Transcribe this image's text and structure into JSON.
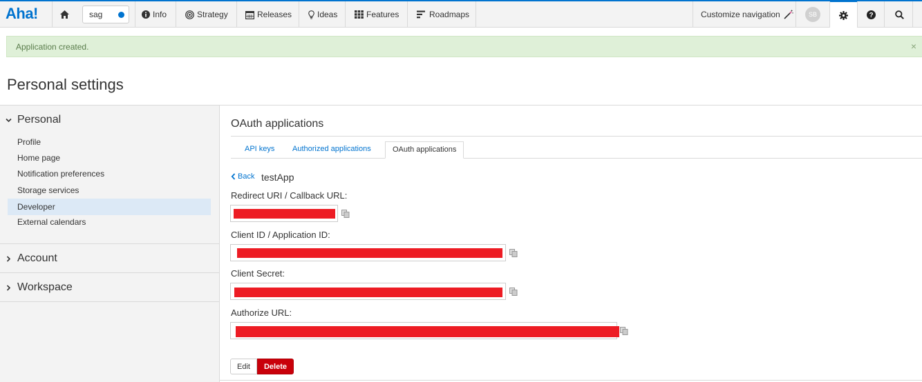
{
  "brand": {
    "logo": "Aha!",
    "accent": "#0073cf"
  },
  "topnav": {
    "workspace_value": "sag",
    "items": [
      {
        "label": "Info",
        "icon": "info-circle-icon"
      },
      {
        "label": "Strategy",
        "icon": "target-icon"
      },
      {
        "label": "Releases",
        "icon": "calendar-icon"
      },
      {
        "label": "Ideas",
        "icon": "lightbulb-icon"
      },
      {
        "label": "Features",
        "icon": "grid-icon"
      },
      {
        "label": "Roadmaps",
        "icon": "roadmap-icon"
      }
    ],
    "customize_label": "Customize navigation",
    "avatar_initials": "SB"
  },
  "flash": {
    "message": "Application created.",
    "close": "×",
    "color": "#dff0d8"
  },
  "page": {
    "title": "Personal settings"
  },
  "sidebar": {
    "personal_label": "Personal",
    "links": [
      "Profile",
      "Home page",
      "Notification preferences",
      "Storage services",
      "Developer",
      "External calendars"
    ],
    "active_link": "Developer",
    "account_label": "Account",
    "workspace_label": "Workspace"
  },
  "main": {
    "title": "OAuth applications",
    "tabs": [
      "API keys",
      "Authorized applications",
      "OAuth applications"
    ],
    "active_tab": "OAuth applications",
    "back_label": "Back",
    "app_name": "testApp",
    "fields": [
      {
        "label": "Redirect URI / Callback URL:",
        "value": "redacted"
      },
      {
        "label": "Client ID / Application ID:",
        "value": "redacted"
      },
      {
        "label": "Client Secret:",
        "value": "redacted"
      },
      {
        "label": "Authorize URL:",
        "value": "redacted"
      }
    ],
    "edit_label": "Edit",
    "delete_label": "Delete",
    "redaction_color": "#ed1c24",
    "delete_color": "#c9000a"
  }
}
